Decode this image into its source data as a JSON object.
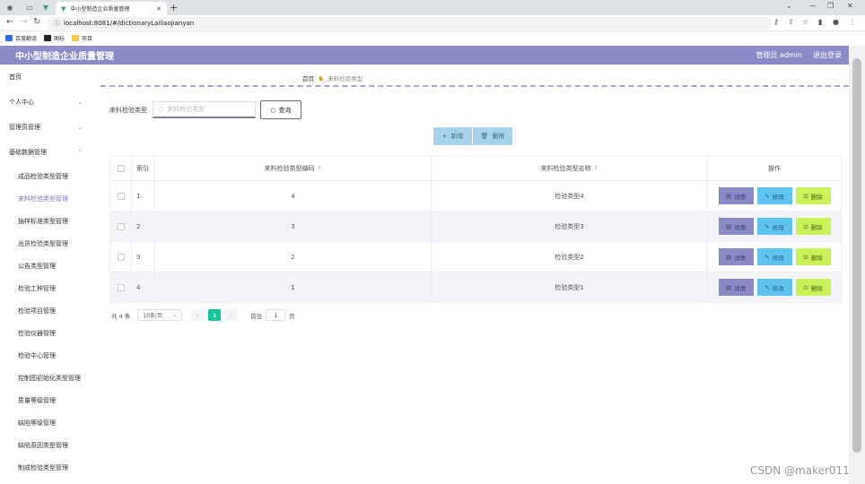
{
  "browser": {
    "tab_title": "中小型制造企业质量管理",
    "url": "localhost:8081/#/dictionaryLailiaojianyan",
    "bookmarks": [
      {
        "label": "百度翻译",
        "color": "#2f6de1"
      },
      {
        "label": "图标",
        "color": "#222222"
      },
      {
        "label": "项目",
        "color": "#f4c542"
      }
    ]
  },
  "header": {
    "title": "中小型制造企业质量管理",
    "user": "管理员 admin",
    "logout": "退出登录",
    "color": "#8a8bc6"
  },
  "sidebar": {
    "top_items": [
      {
        "label": "首页",
        "has_arrow": false
      },
      {
        "label": "个人中心",
        "has_arrow": true
      },
      {
        "label": "管理员管理",
        "has_arrow": true
      },
      {
        "label": "基础数据管理",
        "has_arrow": true
      }
    ],
    "sub_items": [
      {
        "label": "成品检验类型管理"
      },
      {
        "label": "来料检验类型管理",
        "active": true
      },
      {
        "label": "抽样标准类型管理"
      },
      {
        "label": "出货检验类型管理"
      },
      {
        "label": "公告类型管理"
      },
      {
        "label": "检验工种管理"
      },
      {
        "label": "检验项目管理"
      },
      {
        "label": "检验仪器管理"
      },
      {
        "label": "检验中心管理"
      },
      {
        "label": "控制图初始化类型管理"
      },
      {
        "label": "质量等级管理"
      },
      {
        "label": "缺陷等级管理"
      },
      {
        "label": "缺陷原因类型管理"
      },
      {
        "label": "制成检验类型管理"
      }
    ]
  },
  "breadcrumb": {
    "home": "首页",
    "current": "来料检验类型"
  },
  "search": {
    "label": "来料检验类型",
    "placeholder": "来料检验类型",
    "button": "查询"
  },
  "actions": {
    "add": "新增",
    "delete": "删除"
  },
  "table": {
    "columns": {
      "index": "索引",
      "code": "来料检验类型编码",
      "name": "来料检验类型名称",
      "ops": "操作"
    },
    "rows": [
      {
        "index": "1",
        "code": "4",
        "name": "检验类型4"
      },
      {
        "index": "2",
        "code": "3",
        "name": "检验类型3"
      },
      {
        "index": "3",
        "code": "2",
        "name": "检验类型2"
      },
      {
        "index": "4",
        "code": "1",
        "name": "检验类型1"
      }
    ],
    "op_labels": {
      "detail": "详情",
      "edit": "修改",
      "remove": "删除"
    }
  },
  "pagination": {
    "total": "共 4 条",
    "page_size": "10条/页",
    "current_page": "1",
    "goto_label": "前往",
    "goto_value": "1",
    "page_unit": "页"
  },
  "watermark": "CSDN @maker011"
}
